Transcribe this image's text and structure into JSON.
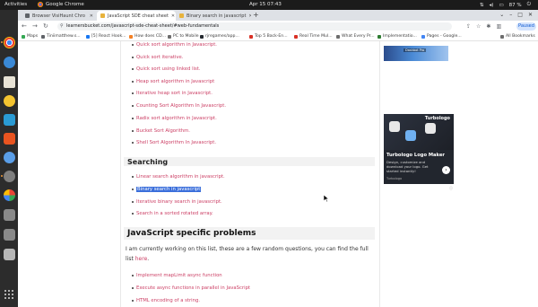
{
  "topbar": {
    "activities": "Activities",
    "app_name": "Google Chrome",
    "clock": "Apr 15  07:43",
    "battery": "87 %"
  },
  "tabs": [
    {
      "title": "Browser VisiHaunt Chro",
      "favicon_color": "#5f6368"
    },
    {
      "title": "JavaScript SDE cheat sheet",
      "favicon_color": "#e8b33c"
    },
    {
      "title": "Binary search in javascript",
      "favicon_color": "#e8b33c"
    }
  ],
  "newtab": "+",
  "omnibox": {
    "url": "learnersbucket.com/javascript-sde-cheat-sheet/#web-fundamentals"
  },
  "profile": {
    "label": "Paused"
  },
  "bookmarks": [
    {
      "label": "Maps",
      "color": "#34a853"
    },
    {
      "label": "Tiniimatthew.s...",
      "color": "#5f6368"
    },
    {
      "label": "[5] React Hook...",
      "color": "#1877f2"
    },
    {
      "label": "How does CD...",
      "color": "#f48024"
    },
    {
      "label": "PC to Mobile",
      "color": "#6d6d6d"
    },
    {
      "label": "rjregames/app...",
      "color": "#24292f"
    },
    {
      "label": "Top 5 Back-En...",
      "color": "#d93025"
    },
    {
      "label": "Real Time Mul...",
      "color": "#d93025"
    },
    {
      "label": "What Every Pr...",
      "color": "#6d6d6d"
    },
    {
      "label": "Implementatio...",
      "color": "#2e7d32"
    },
    {
      "label": "Pages - Google...",
      "color": "#4285f4"
    },
    {
      "label": "All Bookmarks",
      "color": "#6d6d6d"
    }
  ],
  "sort_items": [
    "Quick sort algorithm in Javascript.",
    "Quick sort iterative.",
    "Quick sort using linked list.",
    "Heap sort algorithm in Javascript",
    "Iterative heap sort in Javascript.",
    "Counting Sort Algorithm In Javascript.",
    "Radix sort algorithm in Javascript.",
    "Bucket Sort Algorithm.",
    "Shell Sort Algorithm In Javascript."
  ],
  "searching": {
    "heading": "Searching",
    "items": [
      "Linear search algorithm in javascript.",
      "Binary search in javascript",
      "Iterative binary search in javascript.",
      "Search in a sorted rotated array."
    ]
  },
  "js_problems": {
    "heading": "JavaScript specific problems",
    "intro": "I am currently working on this list, these are a few random questions, you can find the full list",
    "link": "here",
    "items": [
      "Implement mapLimit async function",
      "Execute async functions in parallel in JavaScript",
      "HTML encoding of a string."
    ]
  },
  "ads": {
    "banner_tag": "Dashbot Pro",
    "card": {
      "brand": "Turbologo",
      "title": "Turbologo Logo Maker",
      "desc": "Design, customize and download your logo. Get started instantly!",
      "source": "Turbologo",
      "arrow": "›"
    },
    "adchoice": "ⓘ"
  }
}
